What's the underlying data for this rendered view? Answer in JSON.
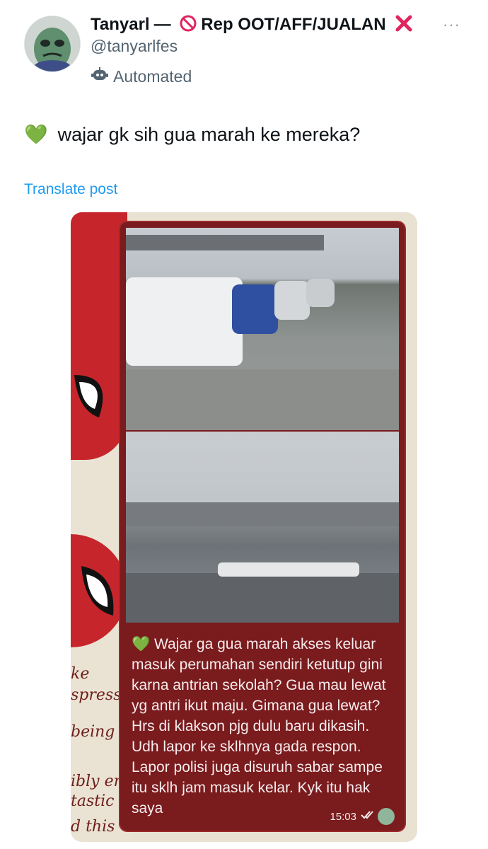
{
  "author": {
    "display_name": "Tanyarl",
    "separator": "—",
    "no_icon": "no-entry-icon",
    "bio_tag": "Rep OOT/AFF/JUALAN",
    "cross_icon": "cross-mark-icon",
    "handle": "@tanyarlfes",
    "automated_label": "Automated",
    "automated_icon": "robot-icon"
  },
  "more_label": "···",
  "post": {
    "emoji": "💚",
    "text": "wajar gk sih gua marah ke mereka?",
    "translate_label": "Translate post"
  },
  "media": {
    "message_emoji": "💚",
    "message_text": "Wajar ga gua marah akses keluar masuk perumahan sendiri ketutup gini karna antrian sekolah? Gua mau lewat yg antri ikut maju. Gimana gua lewat? Hrs di klakson pjg dulu baru dikasih. Udh lapor ke sklhnya gada respon. Lapor polisi juga disuruh sabar sampe itu sklh jam masuk kelar. Kyk itu hak saya",
    "time": "15:03",
    "scribble_lines": [
      "ke",
      "spress",
      "being b",
      "ibly en",
      "tastic",
      "d this"
    ]
  },
  "colors": {
    "link": "#1d9bf0",
    "secondary_text": "#536471",
    "card_bg": "#7a1b1e",
    "spider_red": "#c6262b"
  }
}
